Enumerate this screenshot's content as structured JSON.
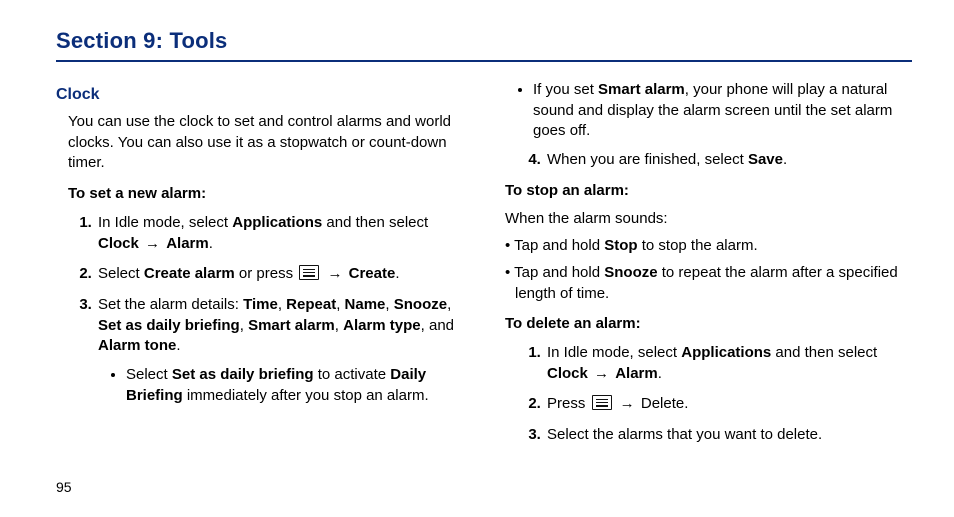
{
  "section_title": "Section 9: Tools",
  "page_number": "95",
  "left": {
    "sub_title": "Clock",
    "intro": "You can use the clock to set and control alarms and world clocks. You can also use it as a stopwatch or count-down timer.",
    "set_alarm_label": "To set a new alarm:",
    "steps": {
      "s1_a": "In Idle mode, select ",
      "s1_apps": "Applications",
      "s1_b": " and then select ",
      "s1_clock": "Clock",
      "s1_arrow": " → ",
      "s1_alarm": "Alarm",
      "s1_end": ".",
      "s2_a": "Select ",
      "s2_create_alarm": "Create alarm",
      "s2_b": " or press  ",
      "s2_arrow": " → ",
      "s2_create": "Create",
      "s2_end": ".",
      "s3_a": "Set the alarm details: ",
      "s3_time": "Time",
      "s3_c1": ", ",
      "s3_repeat": "Repeat",
      "s3_c2": ", ",
      "s3_name": "Name",
      "s3_c3": ", ",
      "s3_snooze": "Snooze",
      "s3_c4": ", ",
      "s3_daily": "Set as daily briefing",
      "s3_c5": ", ",
      "s3_smart": "Smart alarm",
      "s3_c6": ", ",
      "s3_type": "Alarm type",
      "s3_c7": ", and ",
      "s3_tone": "Alarm tone",
      "s3_end": ".",
      "s3_sub_a": "Select ",
      "s3_sub_set": "Set as daily briefing",
      "s3_sub_b": " to activate ",
      "s3_sub_db": "Daily Briefing",
      "s3_sub_c": " immediately after you stop an alarm."
    }
  },
  "right": {
    "s3_sub2_a": "If you set ",
    "s3_sub2_smart": "Smart alarm",
    "s3_sub2_b": ", your phone will play a natural sound and display the alarm screen until the set alarm goes off.",
    "s4_a": "When you are finished, select ",
    "s4_save": "Save",
    "s4_end": ".",
    "stop_label": "To stop an alarm:",
    "stop_intro": "When the alarm sounds:",
    "stop_b1_a": "Tap and hold ",
    "stop_b1_stop": "Stop",
    "stop_b1_b": " to stop the alarm.",
    "stop_b2_a": "Tap and hold ",
    "stop_b2_snooze": "Snooze",
    "stop_b2_b": " to repeat the alarm after a specified length of time.",
    "delete_label": "To delete an alarm:",
    "d1_a": "In Idle mode, select ",
    "d1_apps": "Applications",
    "d1_b": " and then select ",
    "d1_clock": "Clock",
    "d1_arrow": " → ",
    "d1_alarm": "Alarm",
    "d1_end": ".",
    "d2_a": "Press  ",
    "d2_arrow": " → ",
    "d2_delete": "Delete.",
    "d3": "Select the alarms that you want to delete."
  }
}
